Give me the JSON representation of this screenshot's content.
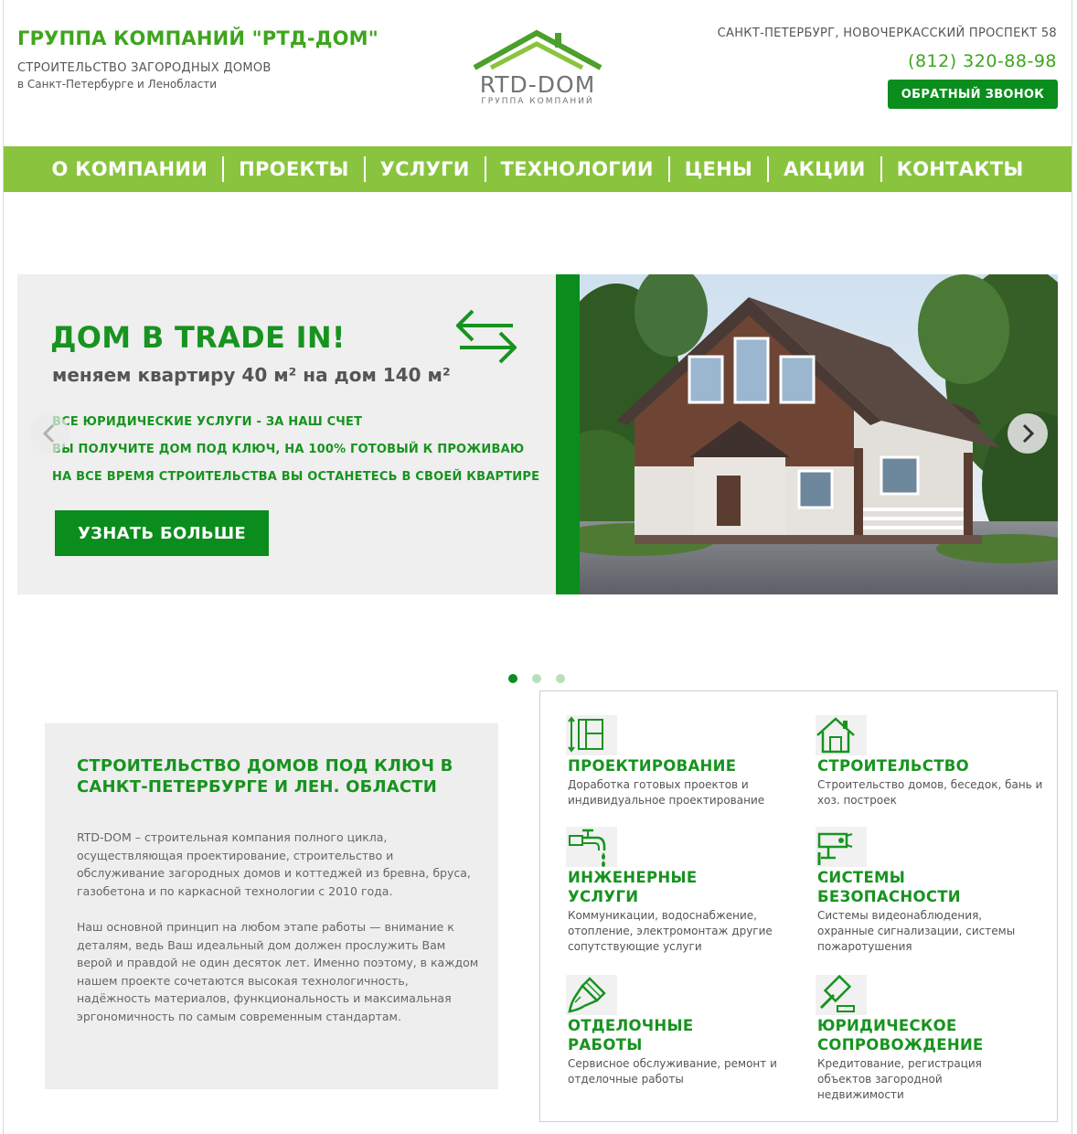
{
  "header": {
    "title": "ГРУППА КОМПАНИЙ \"РТД-ДОМ\"",
    "subtitle_line1": "СТРОИТЕЛЬСТВО ЗАГОРОДНЫХ ДОМОВ",
    "subtitle_line2": "в Санкт-Петербурге и Ленобласти",
    "logo_text": "RTD-DOM",
    "logo_subtext": "ГРУППА КОМПАНИЙ",
    "address": "САНКТ-ПЕТЕРБУРГ, НОВОЧЕРКАССКИЙ ПРОСПЕКТ 58",
    "phone": "(812) 320-88-98",
    "callback_label": "ОБРАТНЫЙ ЗВОНОК"
  },
  "nav": {
    "items": [
      "О КОМПАНИИ",
      "ПРОЕКТЫ",
      "УСЛУГИ",
      "ТЕХНОЛОГИИ",
      "ЦЕНЫ",
      "АКЦИИ",
      "КОНТАКТЫ"
    ]
  },
  "slider": {
    "title": "ДОМ В TRADE IN!",
    "subtitle": "меняем квартиру 40 м² на дом 140 м²",
    "bullets": [
      "ВСЕ ЮРИДИЧЕСКИЕ УСЛУГИ - ЗА НАШ СЧЕТ",
      "ВЫ ПОЛУЧИТЕ ДОМ ПОД КЛЮЧ, НА 100% ГОТОВЫЙ К ПРОЖИВАЮ",
      "НА ВСЕ ВРЕМЯ СТРОИТЕЛЬСТВА ВЫ ОСТАНЕТЕСЬ В СВОЕЙ КВАРТИРЕ"
    ],
    "button_label": "УЗНАТЬ БОЛЬШЕ",
    "slide_count": 3,
    "active_slide": 1
  },
  "about": {
    "title": "СТРОИТЕЛЬСТВО ДОМОВ ПОД КЛЮЧ В САНКТ-ПЕТЕРБУРГЕ И ЛЕН. ОБЛАСТИ",
    "paragraph1": "RTD-DOM – строительная компания полного цикла, осуществляющая проектирование, строительство и обслуживание загородных домов и коттеджей из бревна, бруса, газобетона и по каркасной технологии с 2010 года.",
    "paragraph2": "Наш основной принцип на любом этапе работы — внимание к деталям, ведь Ваш идеальный дом должен прослужить Вам верой и правдой не один десяток лет. Именно поэтому, в каждом нашем проекте сочетаются высокая технологичность, надёжность материалов, функциональность и максимальная эргономичность по самым современным стандартам."
  },
  "services": [
    {
      "icon": "blueprint-icon",
      "title": "ПРОЕКТИРОВАНИЕ",
      "desc": "Доработка готовых проектов и индивидуальное проектирование"
    },
    {
      "icon": "house-icon",
      "title": "СТРОИТЕЛЬСТВО",
      "desc": "Строительство домов, беседок, бань и хоз. построек"
    },
    {
      "icon": "faucet-icon",
      "title": "ИНЖЕНЕРНЫЕ УСЛУГИ",
      "desc": "Коммуникации, водоснабжение, отопление, электромонтаж другие сопутствующие услуги"
    },
    {
      "icon": "cctv-camera-icon",
      "title": "СИСТЕМЫ БЕЗОПАСНОСТИ",
      "desc": "Системы видеонаблюдения, охранные сигнализации, системы пожаротушения"
    },
    {
      "icon": "paint-brush-icon",
      "title": "ОТДЕЛОЧНЫЕ РАБОТЫ",
      "desc": "Сервисное обслуживание, ремонт и отделочные работы"
    },
    {
      "icon": "gavel-icon",
      "title": "ЮРИДИЧЕСКОЕ СОПРОВОЖДЕНИЕ",
      "desc": "Кредитование, регистрация объектов загородной недвижимости"
    }
  ],
  "colors": {
    "brand_green": "#3ea51e",
    "dark_green": "#0b8d1d",
    "nav_green": "#8ac43f"
  }
}
